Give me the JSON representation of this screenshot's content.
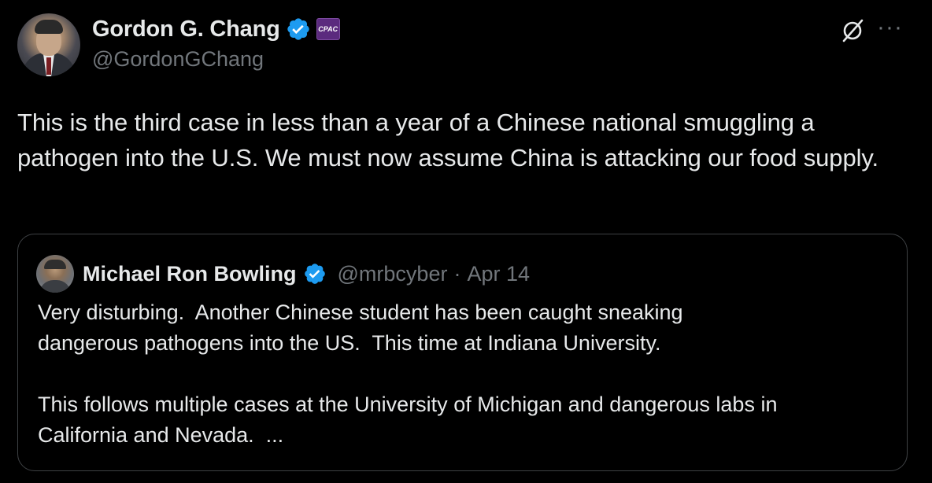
{
  "author": {
    "display_name": "Gordon G. Chang",
    "handle": "@GordonGChang",
    "verified_icon": "verified-badge-icon",
    "affiliation_badge": "CPAC"
  },
  "tweet": {
    "text": "This is the third case in less than a year of a Chinese national smuggling a pathogen into the U.S. We must now assume China is attacking our food supply."
  },
  "quoted_tweet": {
    "display_name": "Michael Ron Bowling",
    "handle": "@mrbcyber",
    "separator": "·",
    "date": "Apr 14",
    "text": "Very disturbing.  Another Chinese student has been caught sneaking\ndangerous pathogens into the US.  This time at Indiana University.\n\nThis follows multiple cases at the University of Michigan and dangerous labs in\nCalifornia and Nevada.  ..."
  },
  "icons": {
    "grok": "grok-icon",
    "more": "more-icon"
  },
  "colors": {
    "background": "#000000",
    "text_primary": "#e7e9ea",
    "text_secondary": "#71767b",
    "verified_blue": "#1d9bf0",
    "border": "#3e4144"
  }
}
